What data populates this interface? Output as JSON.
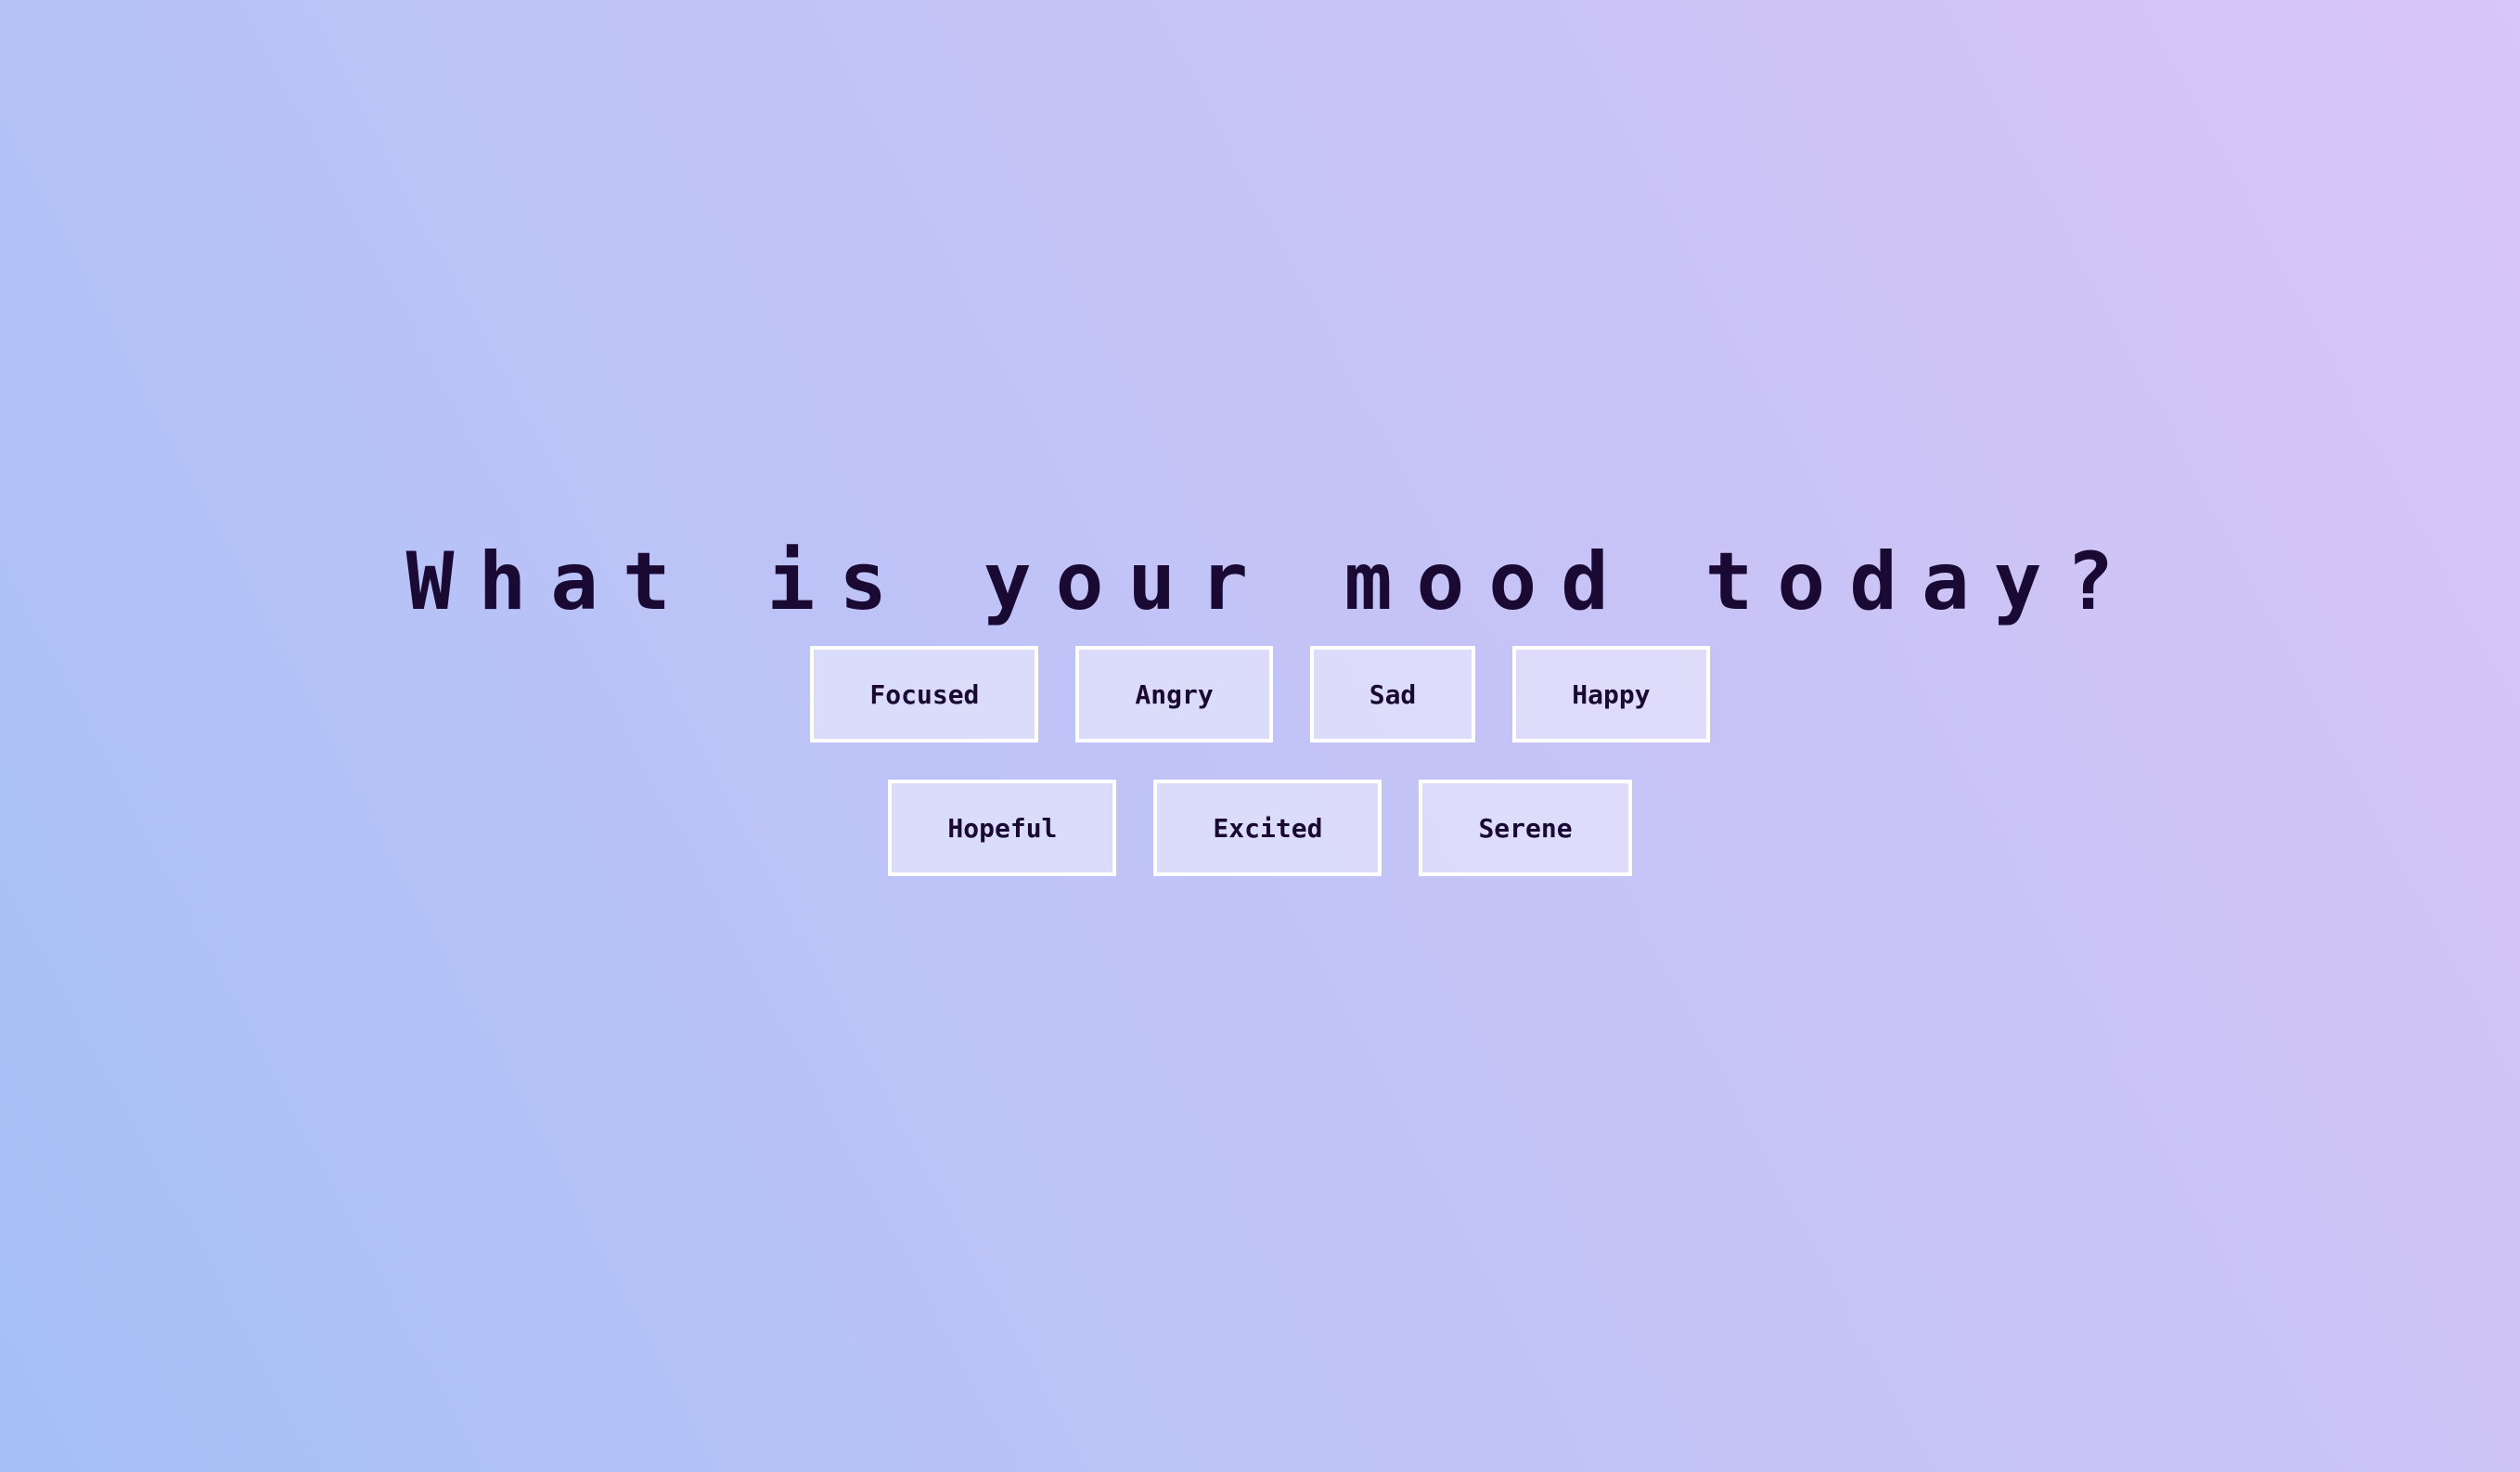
{
  "title": "What is your mood today?",
  "moods_row_1": [
    {
      "label": "Focused"
    },
    {
      "label": "Angry"
    },
    {
      "label": "Sad"
    },
    {
      "label": "Happy"
    }
  ],
  "moods_row_2": [
    {
      "label": "Hopeful"
    },
    {
      "label": "Excited"
    },
    {
      "label": "Serene"
    }
  ],
  "colors": {
    "text": "#1a0a33",
    "button_border": "#ffffff",
    "gradient_start": "#a5c0f5",
    "gradient_end": "#d9c5f7"
  }
}
